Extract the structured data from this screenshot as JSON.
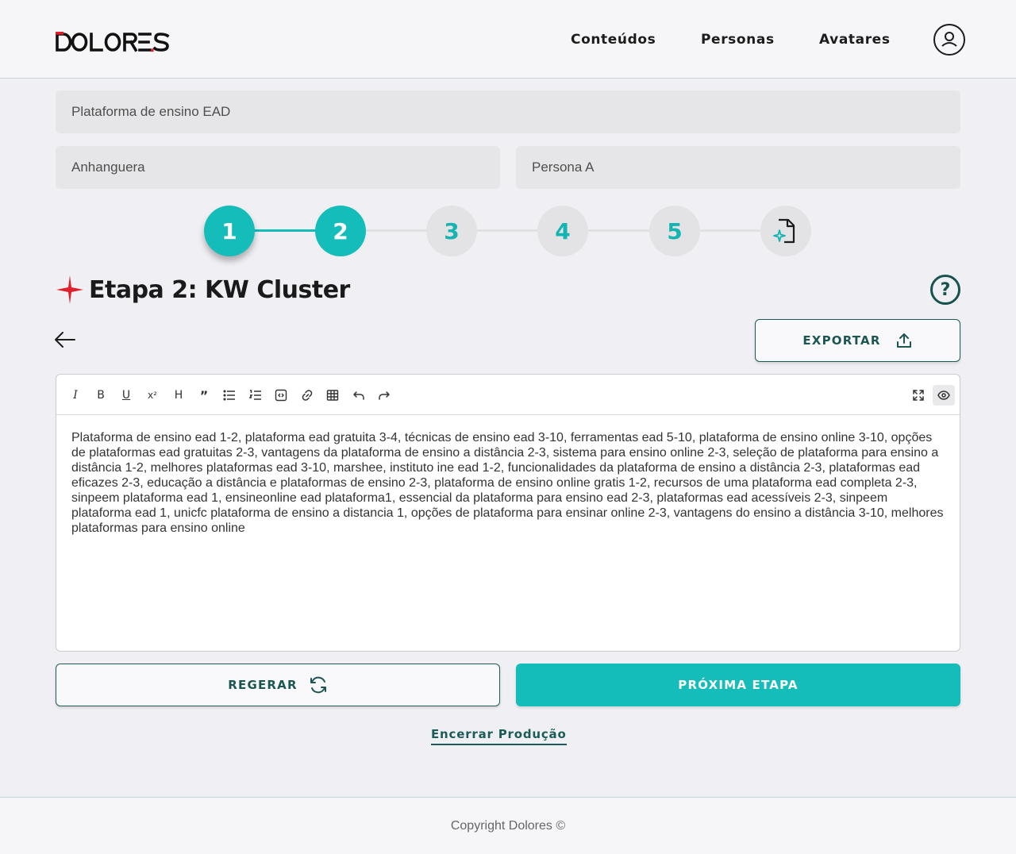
{
  "header": {
    "logo_text": "DOLORES",
    "nav": [
      "Conteúdos",
      "Personas",
      "Avatares"
    ]
  },
  "form": {
    "topic": "Plataforma de ensino EAD",
    "brand": "Anhanguera",
    "persona": "Persona A"
  },
  "stepper": {
    "steps": [
      "1",
      "2",
      "3",
      "4",
      "5"
    ],
    "current_step": 2
  },
  "section": {
    "title": "Etapa 2: KW Cluster"
  },
  "actions": {
    "export_label": "EXPORTAR",
    "regenerate_label": "REGERAR",
    "next_label": "PRÓXIMA ETAPA",
    "end_label": "Encerrar Produção"
  },
  "editor": {
    "toolbar_icons": [
      "italic-icon",
      "bold-icon",
      "underline-icon",
      "superscript-icon",
      "heading-icon",
      "quote-icon",
      "bullet-list-icon",
      "numbered-list-icon",
      "code-block-icon",
      "link-icon",
      "table-icon",
      "undo-icon",
      "redo-icon",
      "fullscreen-icon",
      "preview-icon"
    ],
    "content": "Plataforma de ensino ead 1-2, plataforma ead gratuita 3-4, técnicas de ensino ead 3-10, ferramentas ead 5-10, plataforma de ensino online 3-10, opções de plataformas ead gratuitas 2-3, vantagens da plataforma de ensino a distância 2-3, sistema para ensino online 2-3, seleção de plataforma para ensino a distância 1-2, melhores plataformas ead 3-10, marshee, instituto ine ead 1-2, funcionalidades da plataforma de ensino a distância 2-3, plataformas ead eficazes 2-3, educação a distância e plataformas de ensino 2-3, plataforma de ensino online gratis 1-2, recursos de uma plataforma ead completa 2-3, sinpeem plataforma ead 1, ensineonline ead plataforma1, essencial da plataforma para ensino ead 2-3, plataformas ead acessíveis 2-3, sinpeem plataforma ead 1, unicfc plataforma de ensino a distancia 1, opções de plataforma para ensinar online 2-3, vantagens do ensino a distância 3-10, melhores plataformas para ensino online"
  },
  "footer": {
    "copyright": "Copyright Dolores ©"
  },
  "colors": {
    "accent": "#14bcba",
    "dark_accent": "#1b5652",
    "logo_red": "#e0202a"
  }
}
